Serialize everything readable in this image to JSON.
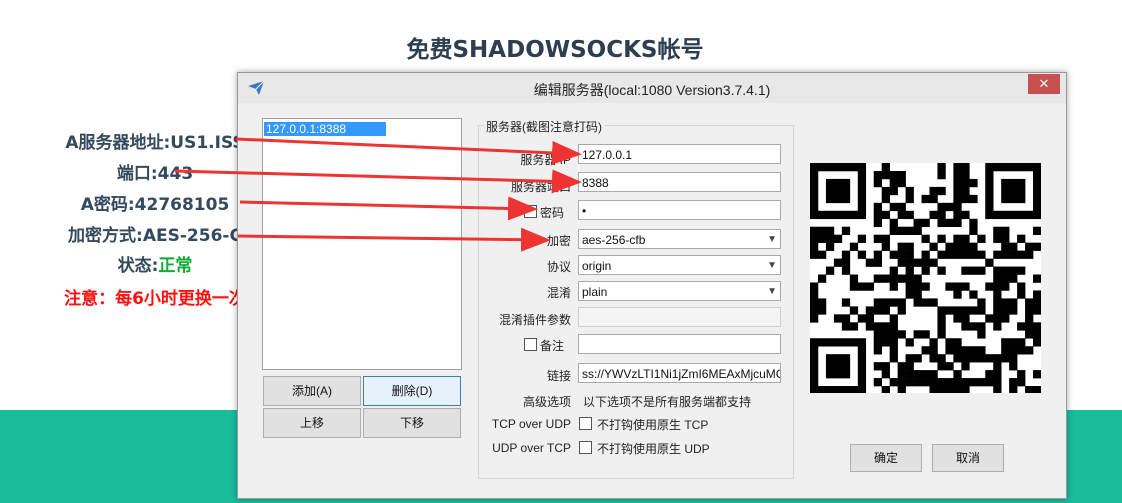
{
  "page": {
    "title": "免费SHADOWSOCKS帐号",
    "info": [
      {
        "label": "A服务器地址:",
        "value": "US1.ISS"
      },
      {
        "label": "端口:",
        "value": "443"
      },
      {
        "label": "A密码:",
        "value": "42768105"
      },
      {
        "label": "加密方式:",
        "value": "AES-256-C"
      },
      {
        "label": "状态:",
        "value": "正常"
      }
    ],
    "notice": "注意：每6小时更换一次"
  },
  "window": {
    "title": "编辑服务器(local:1080 Version3.7.4.1)",
    "close_glyph": "✕",
    "server_list": [
      "127.0.0.1:8388"
    ],
    "buttons": {
      "add": "添加(A)",
      "delete": "删除(D)",
      "move_up": "上移",
      "move_down": "下移",
      "ok": "确定",
      "cancel": "取消"
    },
    "group_label": "服务器(截图注意打码)",
    "fields": {
      "server_label": "服务器 IP",
      "server_value": "127.0.0.1",
      "port_label": "服务器端口",
      "port_value": "8388",
      "password_label": "密码",
      "password_value": "•",
      "encryption_label": "加密",
      "encryption_value": "aes-256-cfb",
      "protocol_label": "协议",
      "protocol_value": "origin",
      "obfs_label": "混淆",
      "obfs_value": "plain",
      "obfs_param_label": "混淆插件参数",
      "obfs_param_value": "",
      "remark_label": "备注",
      "remark_value": "",
      "link_label": "链接",
      "link_value": "ss://YWVzLTI1Ni1jZmI6MEAxMjcuMC"
    },
    "advanced": {
      "label": "高级选项",
      "note": "以下选项不是所有服务端都支持",
      "tcp_label": "TCP over UDP",
      "tcp_option": "不打钩使用原生 TCP",
      "udp_label": "UDP over TCP",
      "udp_option": "不打钩使用原生 UDP"
    }
  },
  "colors": {
    "accent_teal": "#1abc9c",
    "status_green": "#11aa33",
    "notice_red": "#ff1111",
    "arrow_red": "#ee3333",
    "selection_blue": "#3399ff"
  },
  "icons": [
    "paper-plane-icon",
    "close-icon",
    "chevron-down-icon",
    "qr-code-icon"
  ]
}
